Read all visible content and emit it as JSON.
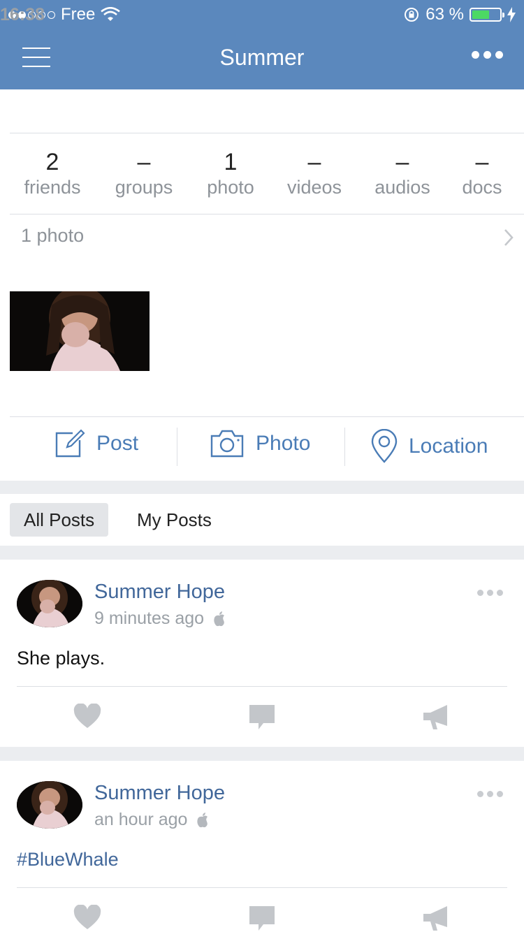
{
  "status_bar": {
    "carrier": "Free",
    "time": "16:38",
    "battery_percent_text": "63 %",
    "battery_level": 0.63,
    "signal_bars_filled": 2,
    "signal_bars_total": 5
  },
  "nav": {
    "title": "Summer"
  },
  "counters": [
    {
      "value": "2",
      "label": "friends"
    },
    {
      "value": "–",
      "label": "groups"
    },
    {
      "value": "1",
      "label": "photo"
    },
    {
      "value": "–",
      "label": "videos"
    },
    {
      "value": "–",
      "label": "audios"
    },
    {
      "value": "–",
      "label": "docs"
    }
  ],
  "photos_section": {
    "label": "1 photo"
  },
  "actions": {
    "post": "Post",
    "photo": "Photo",
    "location": "Location"
  },
  "tabs": {
    "all_posts": "All Posts",
    "my_posts": "My Posts",
    "active": "all_posts"
  },
  "posts": [
    {
      "author": "Summer Hope",
      "time": "9 minutes ago",
      "text": "She plays.",
      "is_tag": false
    },
    {
      "author": "Summer Hope",
      "time": "an hour ago",
      "text": "#BlueWhale",
      "is_tag": true
    }
  ],
  "colors": {
    "header_bg": "#5b88bd",
    "accent": "#4a7cb6",
    "link": "#41679a",
    "battery_fill": "#4cd964",
    "icon_gray": "#c3c6ca"
  },
  "icons": {
    "menu": "hamburger-icon",
    "more": "more-dots-icon",
    "post": "edit-icon",
    "photo": "camera-icon",
    "location": "map-pin-icon",
    "like": "heart-icon",
    "comment": "comment-icon",
    "share": "megaphone-icon",
    "platform": "apple-icon",
    "chevron": "chevron-right-icon"
  }
}
